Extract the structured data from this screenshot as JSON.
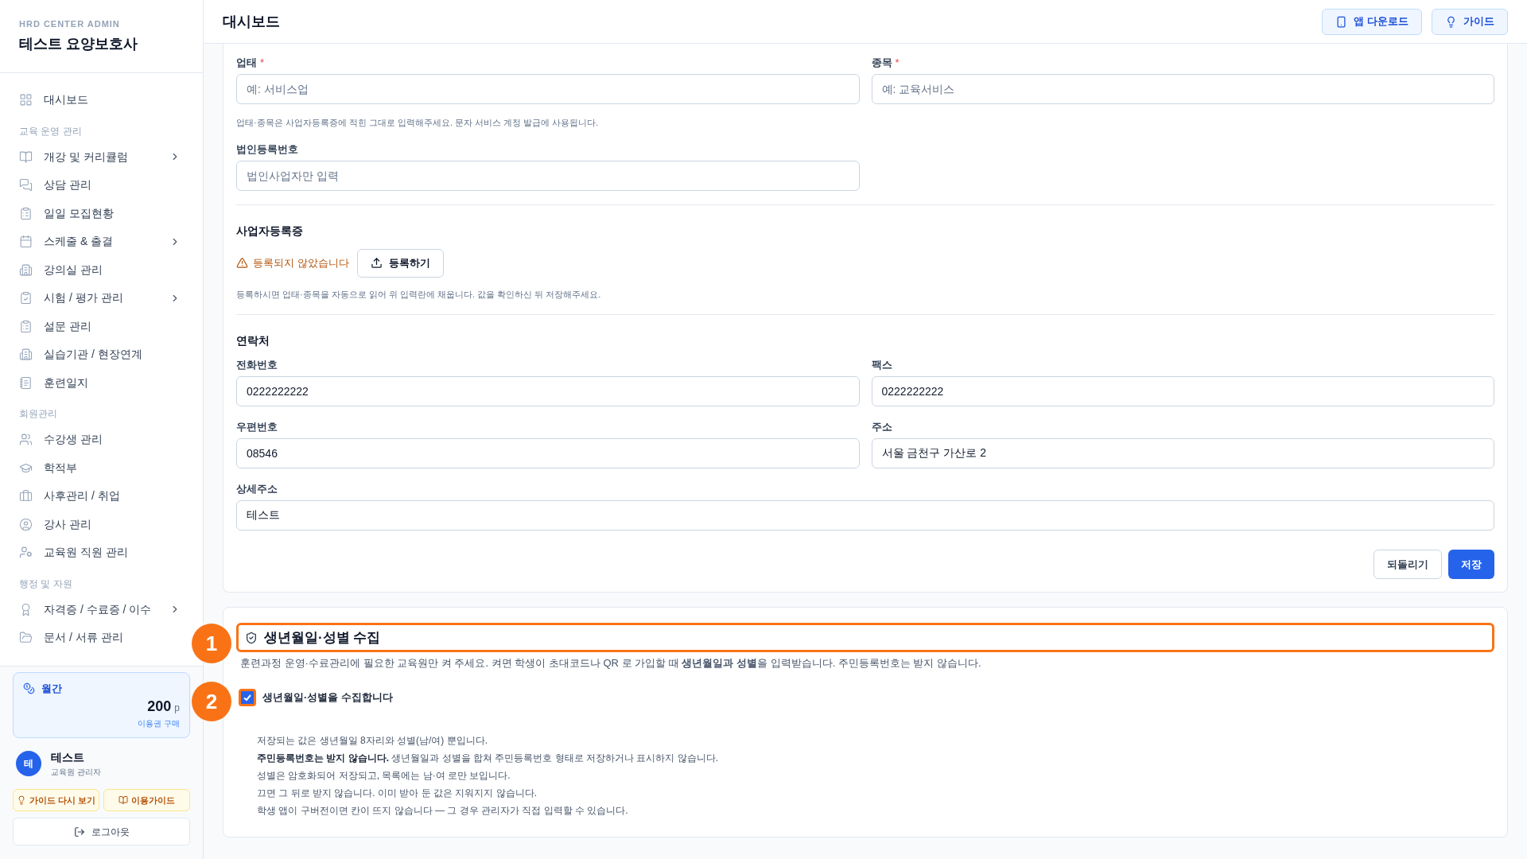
{
  "sidebar": {
    "brand_small": "HRD CENTER ADMIN",
    "brand": "테스트 요양보호사",
    "groups": [
      {
        "items": [
          {
            "label": "대시보드",
            "expandable": false
          }
        ]
      },
      {
        "title": "교육 운영 관리",
        "items": [
          {
            "label": "개강 및 커리큘럼",
            "expandable": true
          },
          {
            "label": "상담 관리",
            "expandable": false
          },
          {
            "label": "일일 모집현황",
            "expandable": false
          },
          {
            "label": "스케줄 & 출결",
            "expandable": true
          },
          {
            "label": "강의실 관리",
            "expandable": false
          },
          {
            "label": "시험 / 평가 관리",
            "expandable": true
          },
          {
            "label": "설문 관리",
            "expandable": false
          },
          {
            "label": "실습기관 / 현장연계",
            "expandable": false
          },
          {
            "label": "훈련일지",
            "expandable": false
          }
        ]
      },
      {
        "title": "회원관리",
        "items": [
          {
            "label": "수강생 관리",
            "expandable": false
          },
          {
            "label": "학적부",
            "expandable": false
          },
          {
            "label": "사후관리 / 취업",
            "expandable": false
          },
          {
            "label": "강사 관리",
            "expandable": false
          },
          {
            "label": "교육원 직원 관리",
            "expandable": false
          }
        ]
      },
      {
        "title": "행정 및 자원",
        "items": [
          {
            "label": "자격증 / 수료증 / 이수",
            "expandable": true
          },
          {
            "label": "문서 / 서류 관리",
            "expandable": false
          }
        ]
      }
    ],
    "plan": {
      "name": "월간",
      "amount": "200",
      "unit": "p",
      "link": "이용권 구매"
    },
    "user": {
      "initial": "테",
      "name": "테스트",
      "role": "교육원 관리자"
    },
    "guide_buttons": [
      "가이드 다시 보기",
      "이용가이드"
    ],
    "logout": "로그아웃"
  },
  "header": {
    "title": "대시보드",
    "buttons": [
      "앱 다운로드",
      "가이드"
    ]
  },
  "business_card": {
    "row1": [
      {
        "label": "업태",
        "mark": "*",
        "placeholder": "예: 서비스업"
      },
      {
        "label": "종목",
        "mark": "*",
        "placeholder": "예: 교육서비스"
      }
    ],
    "row1_help": "업태·종목은 사업자등록증에 적힌 그대로 입력해주세요. 문자 서비스 계정 발급에 사용됩니다.",
    "corp_field": {
      "label": "법인등록번호",
      "placeholder": "법인사업자만 입력"
    },
    "license": {
      "title": "사업자등록증",
      "status": "등록되지 않았습니다",
      "button": "등록하기",
      "help": "등록하시면 업태·종목을 자동으로 읽어 위 입력란에 채웁니다. 값을 확인하신 뒤 저장해주세요."
    },
    "contact": {
      "title": "연락처",
      "fields": [
        {
          "label": "전화번호",
          "value": "0222222222"
        },
        {
          "label": "팩스",
          "value": "0222222222"
        },
        {
          "label": "우편번호",
          "value": "08546"
        },
        {
          "label": "주소",
          "value": "서울 금천구 가산로 2"
        }
      ],
      "detail": {
        "label": "상세주소",
        "value": "테스트"
      }
    },
    "buttons": {
      "reset": "되돌리기",
      "save": "저장"
    }
  },
  "birth_card": {
    "title": "생년월일·성별 수집",
    "description": "훈련과정 운영·수료관리에 필요한 교육원만 켜 주세요. 켜면 학생이 초대코드나 QR 로 가입할 때 **생년월일과 성별**을 입력받습니다. 주민등록번호는 받지 않습니다.",
    "checkbox": {
      "label": "생년월일·성별을 수집합니다",
      "checked": true
    },
    "notes": [
      "저장되는 값은 생년월일 8자리와 성별(남/여) 뿐입니다.",
      "**주민등록번호는 받지 않습니다.** 생년월일과 성별을 합쳐 주민등록번호 형태로 저장하거나 표시하지 않습니다.",
      "성별은 암호화되어 저장되고, 목록에는 남·여 로만 보입니다.",
      "끄면 그 뒤로 받지 않습니다. 이미 받아 둔 값은 지워지지 않습니다.",
      "학생 앱이 구버전이면 칸이 뜨지 않습니다 — 그 경우 관리자가 직접 입력할 수 있습니다."
    ]
  },
  "annotations": [
    "1",
    "2"
  ]
}
